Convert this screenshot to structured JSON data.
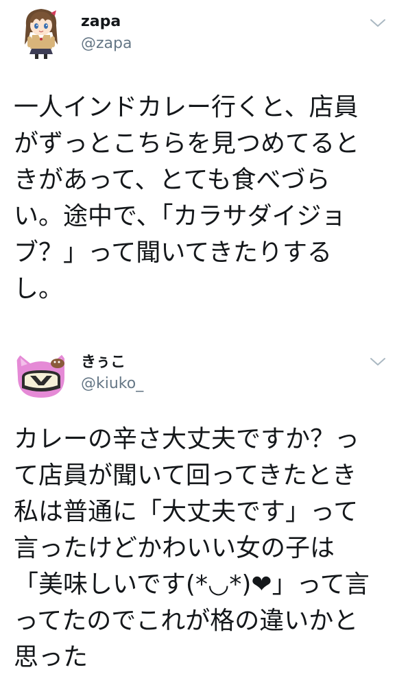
{
  "tweets": [
    {
      "author": {
        "name": "zapa",
        "handle": "@zapa",
        "avatar_icon": "anime-girl-avatar"
      },
      "menu_icon": "chevron-down-icon",
      "text": "一人インドカレー行くと、店員\nがずっとこちらを見つめてると\nきがあって、とても食べづら\nい。途中で、「カラサダイジョ\nブ？」って聞いてきたりする\nし。"
    },
    {
      "author": {
        "name": "きぅこ",
        "handle": "@kiuko_",
        "avatar_icon": "pink-cat-helmet-avatar"
      },
      "menu_icon": "chevron-down-icon",
      "text": "カレーの辛さ大丈夫ですか？っ\nて店員が聞いて回ってきたとき\n私は普通に「大丈夫です」って\n言ったけどかわいい女の子は\n「美味しいです(*◡*)❤」って言\nってたのでこれが格の違いかと\n思った"
    }
  ],
  "colors": {
    "text_primary": "#14171a",
    "text_secondary": "#657786",
    "caret": "#aab8c2",
    "background": "#ffffff"
  }
}
